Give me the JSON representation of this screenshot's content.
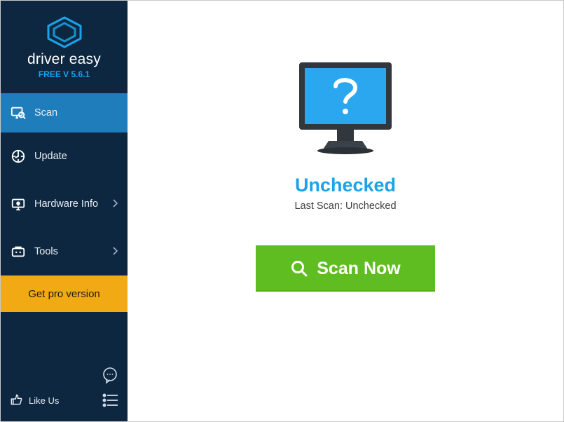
{
  "brand": {
    "name": "driver easy",
    "version": "FREE V 5.6.1"
  },
  "sidebar": {
    "items": [
      {
        "label": "Scan",
        "icon": "scan-icon",
        "active": true,
        "hasSub": false
      },
      {
        "label": "Update",
        "icon": "update-icon",
        "active": false,
        "hasSub": false
      },
      {
        "label": "Hardware Info",
        "icon": "hardware-info-icon",
        "active": false,
        "hasSub": true
      },
      {
        "label": "Tools",
        "icon": "tools-icon",
        "active": false,
        "hasSub": true
      }
    ],
    "pro_label": "Get pro version",
    "like_label": "Like Us"
  },
  "main": {
    "status_title": "Unchecked",
    "status_sub": "Last Scan: Unchecked",
    "scan_button": "Scan Now"
  }
}
